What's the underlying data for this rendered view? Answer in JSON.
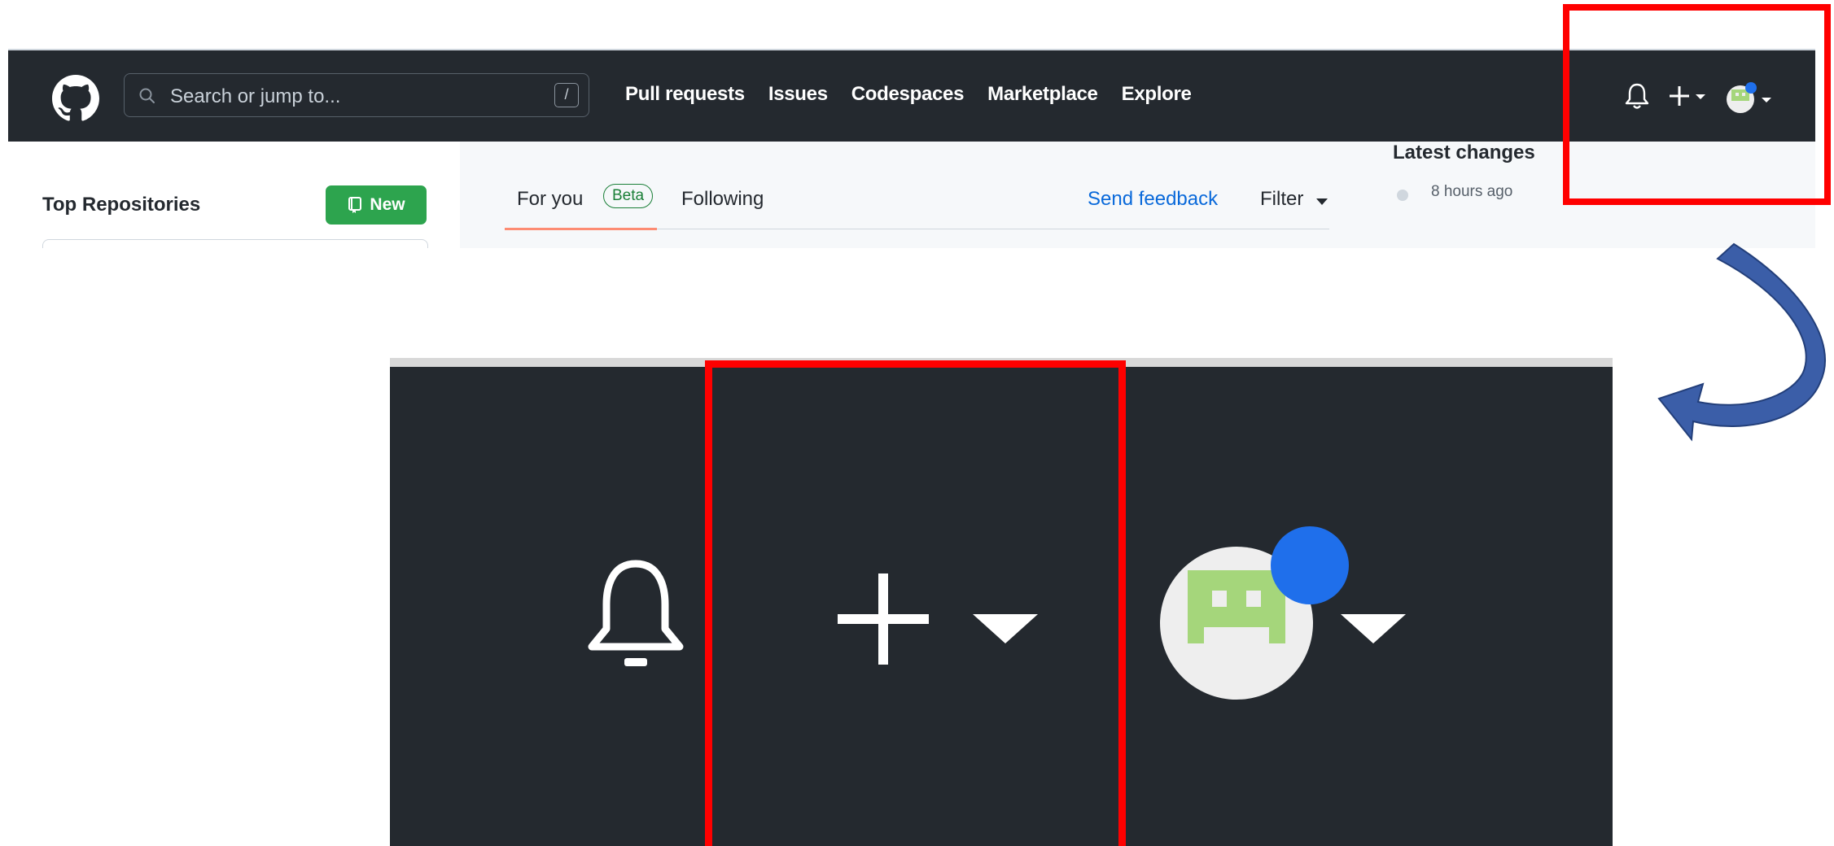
{
  "header": {
    "logo_icon": "github-octocat-icon",
    "search": {
      "placeholder": "Search or jump to...",
      "shortcut": "/"
    },
    "nav": [
      "Pull requests",
      "Issues",
      "Codespaces",
      "Marketplace",
      "Explore"
    ],
    "right_icons": [
      "bell-icon",
      "plus-icon",
      "chevron-down-icon",
      "avatar"
    ]
  },
  "sidebar": {
    "title": "Top Repositories",
    "new_button": "New"
  },
  "feed": {
    "tabs": {
      "for_you": "For you",
      "beta": "Beta",
      "following": "Following"
    },
    "send_feedback": "Send feedback",
    "filter": "Filter"
  },
  "changelog": {
    "title": "Latest changes",
    "first_time": "8 hours ago"
  },
  "annotation": {
    "highlight_color": "#ff0000",
    "arrow_color": "#3b5ea8",
    "zoom_focus": "plus-create-menu-button"
  },
  "colors": {
    "header_bg": "#24292f",
    "new_button_bg": "#2da44e",
    "link": "#0969da",
    "notification_dot": "#1f6feb",
    "avatar_green": "#a5d67b"
  }
}
